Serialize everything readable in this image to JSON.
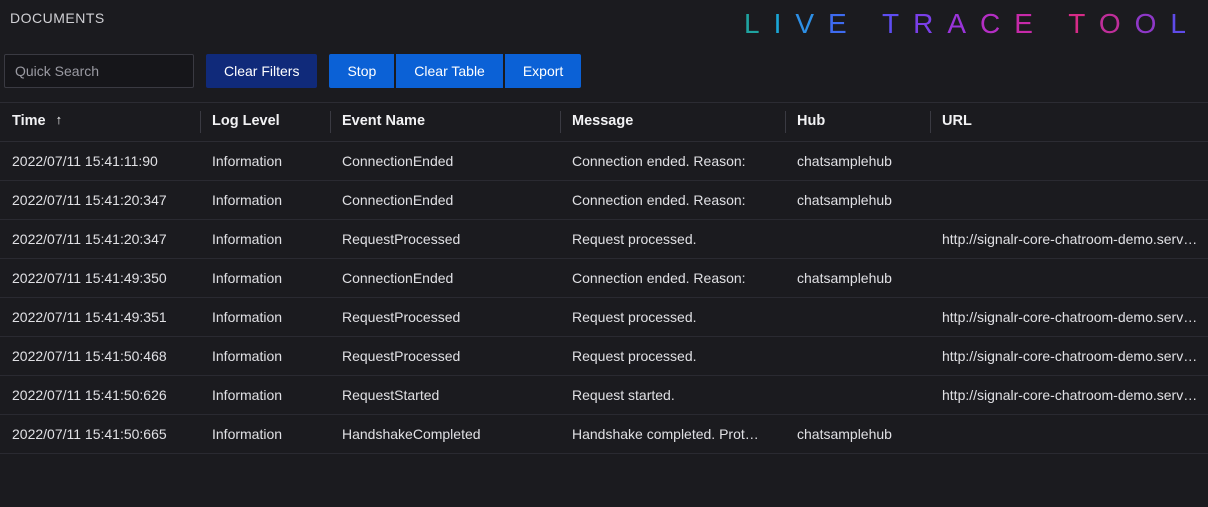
{
  "header": {
    "page_title": "DOCUMENTS",
    "brand_letters": [
      {
        "char": "L",
        "color": "#1fa3a0"
      },
      {
        "char": "I",
        "color": "#1aa6d6"
      },
      {
        "char": "V",
        "color": "#2d8fe6"
      },
      {
        "char": "E",
        "color": "#3e6bf0"
      },
      {
        "char": " ",
        "color": "#000"
      },
      {
        "char": "T",
        "color": "#5e4df2"
      },
      {
        "char": "R",
        "color": "#7a3fe8"
      },
      {
        "char": "A",
        "color": "#9a34da"
      },
      {
        "char": "C",
        "color": "#b42ec4"
      },
      {
        "char": "E",
        "color": "#c62aa9"
      },
      {
        "char": " ",
        "color": "#000"
      },
      {
        "char": "T",
        "color": "#d62b87"
      },
      {
        "char": "O",
        "color": "#bf2e9a"
      },
      {
        "char": "O",
        "color": "#8e38c7"
      },
      {
        "char": "L",
        "color": "#5f4be8"
      }
    ]
  },
  "toolbar": {
    "search_placeholder": "Quick Search",
    "clear_filters": "Clear Filters",
    "stop": "Stop",
    "clear_table": "Clear Table",
    "export": "Export"
  },
  "columns": {
    "time": "Time",
    "log_level": "Log Level",
    "event_name": "Event Name",
    "message": "Message",
    "hub": "Hub",
    "url": "URL"
  },
  "sort": {
    "column": "time",
    "direction_glyph": "↑"
  },
  "rows": [
    {
      "time": "2022/07/11 15:41:11:90",
      "level": "Information",
      "event": "ConnectionEnded",
      "message": "Connection ended. Reason:",
      "hub": "chatsamplehub",
      "url": ""
    },
    {
      "time": "2022/07/11 15:41:20:347",
      "level": "Information",
      "event": "ConnectionEnded",
      "message": "Connection ended. Reason:",
      "hub": "chatsamplehub",
      "url": ""
    },
    {
      "time": "2022/07/11 15:41:20:347",
      "level": "Information",
      "event": "RequestProcessed",
      "message": "Request processed.",
      "hub": "",
      "url": "http://signalr-core-chatroom-demo.service"
    },
    {
      "time": "2022/07/11 15:41:49:350",
      "level": "Information",
      "event": "ConnectionEnded",
      "message": "Connection ended. Reason:",
      "hub": "chatsamplehub",
      "url": ""
    },
    {
      "time": "2022/07/11 15:41:49:351",
      "level": "Information",
      "event": "RequestProcessed",
      "message": "Request processed.",
      "hub": "",
      "url": "http://signalr-core-chatroom-demo.service"
    },
    {
      "time": "2022/07/11 15:41:50:468",
      "level": "Information",
      "event": "RequestProcessed",
      "message": "Request processed.",
      "hub": "",
      "url": "http://signalr-core-chatroom-demo.service"
    },
    {
      "time": "2022/07/11 15:41:50:626",
      "level": "Information",
      "event": "RequestStarted",
      "message": "Request started.",
      "hub": "",
      "url": "http://signalr-core-chatroom-demo.service"
    },
    {
      "time": "2022/07/11 15:41:50:665",
      "level": "Information",
      "event": "HandshakeCompleted",
      "message": "Handshake completed. Prot…",
      "hub": "chatsamplehub",
      "url": ""
    }
  ]
}
